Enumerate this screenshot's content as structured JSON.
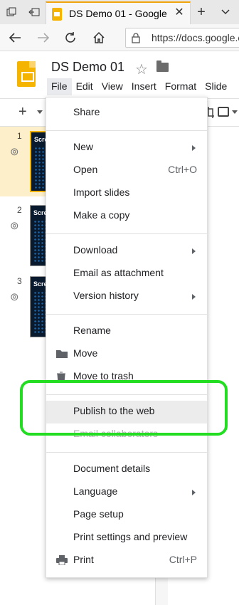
{
  "browser": {
    "tab_title": "DS Demo 01 - Google S",
    "url": "https://docs.google.co"
  },
  "doc": {
    "title": "DS Demo 01",
    "menu": [
      "File",
      "Edit",
      "View",
      "Insert",
      "Format",
      "Slide"
    ]
  },
  "filmstrip": {
    "slides": [
      {
        "number": "1",
        "thumb_text": "Scre"
      },
      {
        "number": "2",
        "thumb_text": "Scre"
      },
      {
        "number": "3",
        "thumb_text": "Scre"
      }
    ]
  },
  "file_menu": {
    "share": "Share",
    "new": "New",
    "open": "Open",
    "open_shortcut": "Ctrl+O",
    "import_slides": "Import slides",
    "make_copy": "Make a copy",
    "download": "Download",
    "email_attachment": "Email as attachment",
    "version_history": "Version history",
    "rename": "Rename",
    "move": "Move",
    "move_to_trash": "Move to trash",
    "publish": "Publish to the web",
    "email_collaborators": "Email collaborators",
    "document_details": "Document details",
    "language": "Language",
    "page_setup": "Page setup",
    "print_settings": "Print settings and preview",
    "print": "Print",
    "print_shortcut": "Ctrl+P"
  },
  "colors": {
    "annotation": "#22dd22",
    "slides_brand": "#f4b400"
  }
}
